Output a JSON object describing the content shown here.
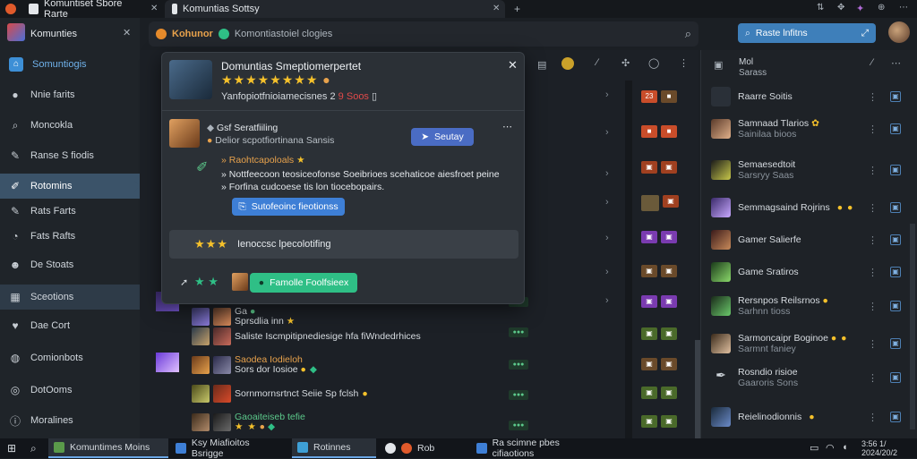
{
  "browser": {
    "tabs": [
      {
        "label": "Komuntiset Sbore Rarte"
      },
      {
        "label": "Komuntias Sottsy"
      }
    ],
    "address_text": "Kohunor",
    "address_sub": "Komontiastoiel clogies"
  },
  "header": {
    "search_button": "Raste lnfitns"
  },
  "sidebar": {
    "app_title": "Komunties",
    "items": [
      {
        "label": "Somuntiogis"
      },
      {
        "label": "Nnie farits"
      },
      {
        "label": "Moncokla"
      },
      {
        "label": "Ranse S fiodis"
      },
      {
        "label": "Rotomins"
      },
      {
        "label": "Rats Farts"
      },
      {
        "label": "Fats Rafts"
      },
      {
        "label": "De Stoats"
      },
      {
        "label": "Sceotions"
      },
      {
        "label": "Dae Cort"
      },
      {
        "label": "Comionbots"
      },
      {
        "label": "DotOoms"
      },
      {
        "label": "Moralines"
      }
    ]
  },
  "modal": {
    "title": "Domuntias Smeptiomerpertet",
    "subtitle_text": "Yanfopiotfnioiamecisnes",
    "subtitle_num_a": "2",
    "subtitle_num_b": "9",
    "subtitle_suffix": "Soos",
    "card_title": "Gsf Seratfiiling",
    "card_sub": "Delior scpotfiortinana Sansis",
    "card_button": "Seutay",
    "bullets": [
      "Raohtcapoloals",
      "Nottfeecoon teosiceofonse Soeibrioes scehaticoe aiesfroet peine",
      "Forfina cudcoese tis lon tiocebopairs."
    ],
    "action_button": "Sutofeoinc fieotionss",
    "rating_text": "Ienoccsc lpecolotifing",
    "footer_button": "Famolle Foolfsieex"
  },
  "list_rows": [
    {
      "title": "Ga",
      "title2": "Sprsdlia inn"
    },
    {
      "title": "Saliste Iscmpitipnediesige hfa fiWndedrhices"
    },
    {
      "title": "Saodea Iodieloh"
    },
    {
      "title": "Sors dor Iosioe"
    },
    {
      "title": "Sornmornsrtnct Seiie Sp fclsh"
    },
    {
      "title": "Gaoaiteiseb tefie"
    }
  ],
  "rightpanel": {
    "header_a": "Mol",
    "header_b": "Sarass",
    "rows": [
      {
        "title": "Raarre Soitis",
        "sub": ""
      },
      {
        "title": "Samnaad Tlarios",
        "sub": "Sainilaa bioos"
      },
      {
        "title": "Semaesedtoit",
        "sub": "Sarsryy Saas"
      },
      {
        "title": "Semmagsaind Rojrins",
        "sub": ""
      },
      {
        "title": "Gamer Salierfe",
        "sub": ""
      },
      {
        "title": "Game Sratiros",
        "sub": ""
      },
      {
        "title": "Rersnpos Reilsrnos",
        "sub": "Sarhnn tioss"
      },
      {
        "title": "Sarmoncaipr Boginoe",
        "sub": "Sarmnt faniey"
      },
      {
        "title": "Rosndio risioe",
        "sub": "Gaaroris Sons"
      },
      {
        "title": "Reielinodionnis",
        "sub": ""
      }
    ]
  },
  "taskbar": {
    "items": [
      {
        "label": "Komuntimes Moins"
      },
      {
        "label": "Ksy Miafioitos Bsrigge"
      },
      {
        "label": "Rotinnes"
      },
      {
        "label": "Rob"
      },
      {
        "label": "Ra scimne pbes cifiaotions"
      }
    ],
    "clock_time": "3:56 1/",
    "clock_date": "2024/20/2"
  },
  "colors": {
    "accent": "#4a84c4",
    "green_button": "#2fbf86",
    "active_sidebar": "#3b5369",
    "star": "#f5c12b"
  }
}
